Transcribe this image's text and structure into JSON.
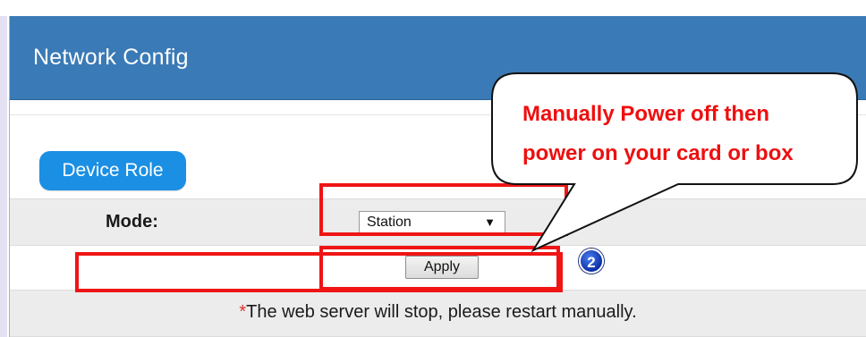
{
  "panel": {
    "title": "Network Config"
  },
  "device_role": {
    "label": "Device Role"
  },
  "mode_row": {
    "label": "Mode:",
    "selected": "Station",
    "dropdown_glyph": "▼"
  },
  "apply_row": {
    "apply_label": "Apply",
    "step_number": "2"
  },
  "note_row": {
    "asterisk": "*",
    "text": "The web server will stop, please restart manually."
  },
  "callout": {
    "line1": "Manually Power off then",
    "line2": "power on your card or box"
  },
  "colors": {
    "header": "#3a7ab6",
    "role_pill": "#1a8fe3",
    "highlight": "#ef1515",
    "callout_text": "#ee0f0f"
  }
}
